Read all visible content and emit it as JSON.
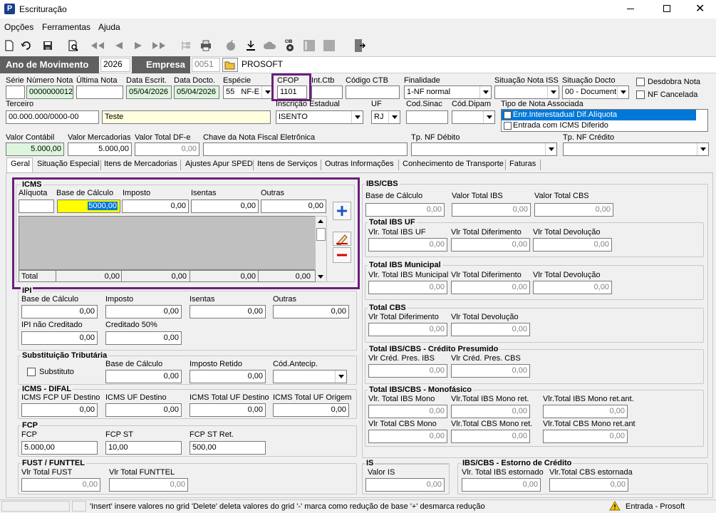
{
  "window": {
    "title": "Escrituração",
    "icon_letter": "P"
  },
  "menu": [
    "Opções",
    "Ferramentas",
    "Ajuda"
  ],
  "movimento": {
    "label": "Ano de Movimento",
    "ano": "2026",
    "empresa_label": "Empresa",
    "empresa_code": "0051",
    "empresa_name": "PROSOFT"
  },
  "header": {
    "serie": {
      "label": "Série",
      "value": ""
    },
    "numero_nota": {
      "label": "Número Nota",
      "value": "0000000012"
    },
    "ultima_nota": {
      "label": "Última Nota",
      "value": ""
    },
    "data_escrit": {
      "label": "Data Escrit.",
      "value": "05/04/2026"
    },
    "data_docto": {
      "label": "Data Docto.",
      "value": "05/04/2026"
    },
    "especie": {
      "label": "Espécie",
      "code": "55",
      "value": "NF-E"
    },
    "cfop": {
      "label": "CFOP",
      "value": "1101"
    },
    "int_ctb": {
      "label": "Int.Ctb",
      "value": ""
    },
    "codigo_ctb": {
      "label": "Código CTB",
      "value": ""
    },
    "finalidade": {
      "label": "Finalidade",
      "value": "1-NF normal"
    },
    "situacao_iss": {
      "label": "Situação Nota ISS",
      "value": ""
    },
    "situacao_docto": {
      "label": "Situação Docto",
      "value": "00 - Document"
    },
    "desdobra_nota": "Desdobra Nota",
    "nf_cancelada": "NF Cancelada",
    "terceiro": {
      "label": "Terceiro",
      "doc": "00.000.000/0000-00",
      "name": "Teste"
    },
    "inscricao_estadual": {
      "label": "Inscrição Estadual",
      "value": "ISENTO"
    },
    "uf": {
      "label": "UF",
      "value": "RJ"
    },
    "cod_sinac": {
      "label": "Cod.Sinac",
      "value": ""
    },
    "cod_dipam": {
      "label": "Cód.Dipam",
      "value": ""
    },
    "tipo_nota": {
      "label": "Tipo de Nota Associada",
      "options": [
        "Entr.Interestadual Dif.Alíquota",
        "Entrada com ICMS Diferido"
      ]
    },
    "valor_contabil": {
      "label": "Valor Contábil",
      "value": "5.000,00"
    },
    "valor_mercadorias": {
      "label": "Valor Mercadorias",
      "value": "5.000,00"
    },
    "valor_total_dfe": {
      "label": "Valor Total DF-e",
      "value": "0,00"
    },
    "chave_nfe": {
      "label": "Chave da Nota Fiscal Eletrônica",
      "value": ""
    },
    "tp_nf_debito": {
      "label": "Tp. NF Débito",
      "value": ""
    },
    "tp_nf_credito": {
      "label": "Tp. NF Crédito",
      "value": ""
    }
  },
  "tabs": [
    "Geral",
    "Situação Especial",
    "Itens de Mercadorias",
    "Ajustes Apur SPED",
    "Itens de Serviços",
    "Outras Informações",
    "Conhecimento de Transporte",
    "Faturas"
  ],
  "icms": {
    "title": "ICMS",
    "cols": [
      "Alíquota",
      "Base de Cálculo",
      "Imposto",
      "Isentas",
      "Outras"
    ],
    "values": [
      "",
      "5000,00",
      "0,00",
      "0,00",
      "0,00"
    ],
    "total_label": "Total",
    "totals": [
      "0,00",
      "0,00",
      "0,00",
      "0,00"
    ]
  },
  "ipi": {
    "title": "IPI",
    "cols": [
      "Base de Cálculo",
      "Imposto",
      "Isentas",
      "Outras"
    ],
    "values": [
      "0,00",
      "0,00",
      "0,00",
      "0,00"
    ],
    "nao_creditado": {
      "label": "IPI não Creditado",
      "value": "0,00"
    },
    "creditado50": {
      "label": "Creditado 50%",
      "value": "0,00"
    }
  },
  "st": {
    "title": "Substituição Tributária",
    "substituto": "Substituto",
    "base": {
      "label": "Base de Cálculo",
      "value": "0,00"
    },
    "retido": {
      "label": "Imposto Retido",
      "value": "0,00"
    },
    "antecip": {
      "label": "Cód.Antecip.",
      "value": ""
    }
  },
  "difal": {
    "title": "ICMS - DIFAL",
    "cols": [
      "ICMS FCP UF Destino",
      "ICMS UF Destino",
      "ICMS Total UF Destino",
      "ICMS Total UF Origem"
    ],
    "values": [
      "0,00",
      "0,00",
      "0,00",
      "0,00"
    ]
  },
  "fcp": {
    "title": "FCP",
    "cols": [
      "FCP",
      "FCP ST",
      "FCP ST Ret."
    ],
    "values": [
      "5.000,00",
      "10,00",
      "500,00"
    ]
  },
  "fust": {
    "title": "FUST / FUNTTEL",
    "cols": [
      "Vlr Total FUST",
      "Vlr Total FUNTTEL"
    ],
    "values": [
      "0,00",
      "0,00"
    ]
  },
  "ibscbs": {
    "title": "IBS/CBS",
    "cols": [
      "Base de Cálculo",
      "Valor Total IBS",
      "Valor Total CBS"
    ],
    "values": [
      "0,00",
      "0,00",
      "0,00"
    ]
  },
  "ibs_uf": {
    "title": "Total IBS UF",
    "cols": [
      "Vlr. Total IBS UF",
      "Vlr Total Diferimento",
      "Vlr Total Devolução"
    ],
    "values": [
      "0,00",
      "0,00",
      "0,00"
    ]
  },
  "ibs_mun": {
    "title": "Total IBS Municipal",
    "cols": [
      "Vlr. Total IBS Municipal",
      "Vlr Total Diferimento",
      "Vlr Total Devolução"
    ],
    "values": [
      "0,00",
      "0,00",
      "0,00"
    ]
  },
  "cbs": {
    "title": "Total CBS",
    "cols": [
      "Vlr Total Diferimento",
      "Vlr Total Devolução"
    ],
    "values": [
      "0,00",
      "0,00"
    ]
  },
  "presumido": {
    "title": "Total IBS/CBS - Crédito Presumido",
    "cols": [
      "Vlr Créd. Pres. IBS",
      "Vlr Créd. Pres. CBS"
    ],
    "values": [
      "0,00",
      "0,00"
    ]
  },
  "monofasico": {
    "title": "Total IBS/CBS - Monofásico",
    "cols": [
      "Vlr. Total IBS Mono",
      "Vlr.Total IBS Mono ret.",
      "Vlr.Total IBS Mono ret.ant.",
      "Vlr Total CBS Mono",
      "Vlr.Total CBS Mono ret.",
      "Vlr.Total CBS Mono ret.ant"
    ],
    "values": [
      "0,00",
      "0,00",
      "0,00",
      "0,00",
      "0,00",
      "0,00"
    ]
  },
  "is": {
    "title": "IS",
    "label": "Valor IS",
    "value": "0,00"
  },
  "estorno": {
    "title": "IBS/CBS - Estorno de Crédito",
    "cols": [
      "Vlr. Total IBS estornado",
      "Vlr.Total CBS estornada"
    ],
    "values": [
      "0,00",
      "0,00"
    ]
  },
  "status": {
    "hint": "'Insert' insere valores no grid 'Delete' deleta valores do grid '-' marca como redução de base '+' desmarca redução",
    "mode": "Entrada - Prosoft"
  },
  "colors": {
    "highlight": "#6b1f7a",
    "selection": "#0078d7",
    "green_field": "#ddf5dd"
  }
}
